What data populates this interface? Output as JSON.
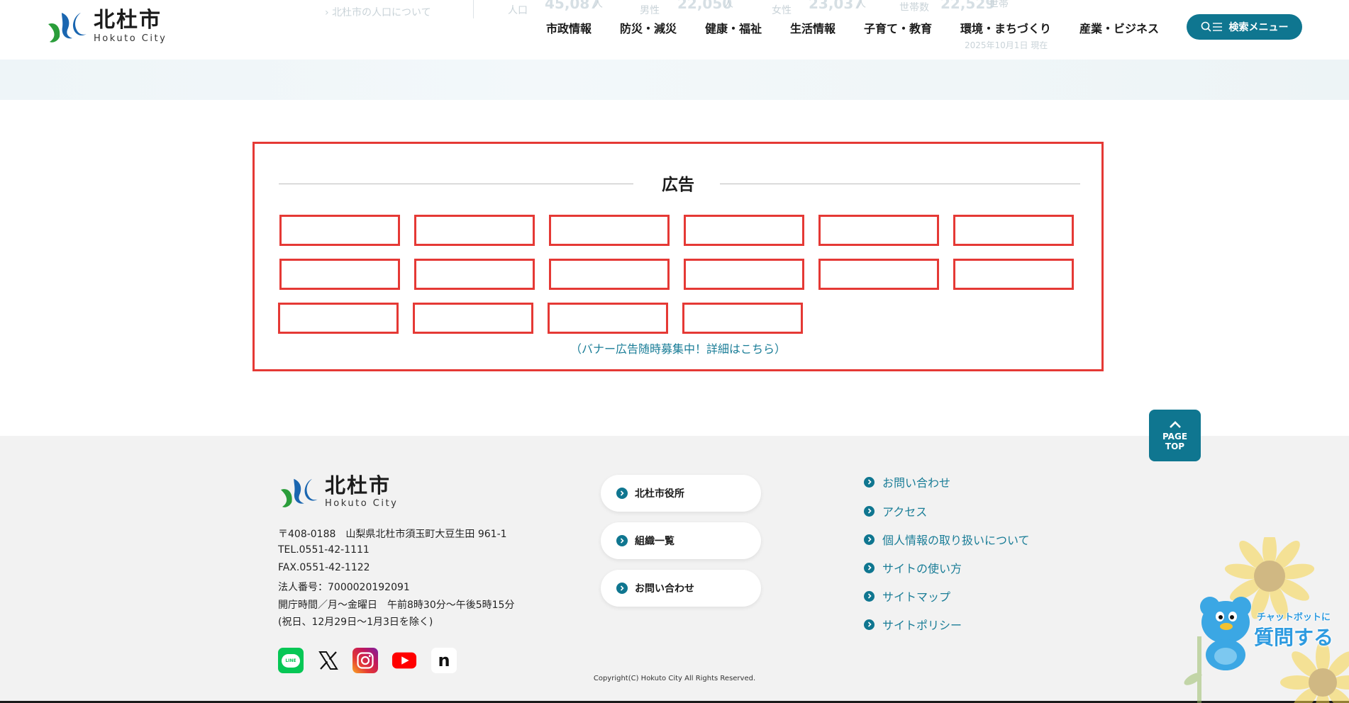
{
  "colors": {
    "accent": "#0f7690",
    "ad_border": "#e53935",
    "link": "#1a7d97",
    "footer_bg": "#f2f2f2"
  },
  "header": {
    "logo_jp": "北杜市",
    "logo_en": "Hokuto City",
    "population_link": "北杜市の人口について",
    "ghost_stats": {
      "population_label": "人口",
      "population_value": "45,087",
      "population_unit": "人",
      "male_label": "男性",
      "male_value": "22,050",
      "male_unit": "人",
      "female_label": "女性",
      "female_value": "23,037",
      "female_unit": "人",
      "households_label": "世帯数",
      "households_value": "22,529",
      "households_unit": "世帯",
      "as_of": "2025年10月1日 現在"
    },
    "nav": [
      {
        "label": "市政情報"
      },
      {
        "label": "防災・減災"
      },
      {
        "label": "健康・福祉"
      },
      {
        "label": "生活情報"
      },
      {
        "label": "子育て・教育"
      },
      {
        "label": "環境・まちづくり"
      },
      {
        "label": "産業・ビジネス"
      }
    ],
    "search_label": "検索メニュー",
    "search_icon": "search-menu-icon"
  },
  "ads": {
    "title": "広告",
    "banner_count": 16,
    "recruit_link": "（バナー広告随時募集中！詳細はこちら）"
  },
  "page_top": {
    "line1": "PAGE",
    "line2": "TOP",
    "icon": "chevron-up-icon"
  },
  "footer": {
    "logo_jp": "北杜市",
    "logo_en": "Hokuto City",
    "address": "〒408-0188　山梨県北杜市須玉町大豆生田 961-1",
    "tel": "TEL.0551-42-1111",
    "fax": "FAX.0551-42-1122",
    "corp_no": "法人番号：7000020192091",
    "hours": "開庁時間／月～金曜日　午前8時30分～午後5時15分",
    "holidays": "(祝日、12月29日～1月3日を除く)",
    "social": [
      "line-icon",
      "x-icon",
      "instagram-icon",
      "youtube-icon",
      "note-icon"
    ],
    "line_icon_text": "LINE",
    "note_icon_text": "n",
    "pills": [
      {
        "label": "北杜市役所"
      },
      {
        "label": "組織一覧"
      },
      {
        "label": "お問い合わせ"
      }
    ],
    "links": [
      {
        "label": "お問い合わせ"
      },
      {
        "label": "アクセス"
      },
      {
        "label": "個人情報の取り扱いについて"
      },
      {
        "label": "サイトの使い方"
      },
      {
        "label": "サイトマップ"
      },
      {
        "label": "サイトポリシー"
      }
    ],
    "copyright": "Copyright(C) Hokuto City All Rights Reserved."
  },
  "chatbot": {
    "line1": "チャットボットに",
    "line2": "質問する"
  }
}
